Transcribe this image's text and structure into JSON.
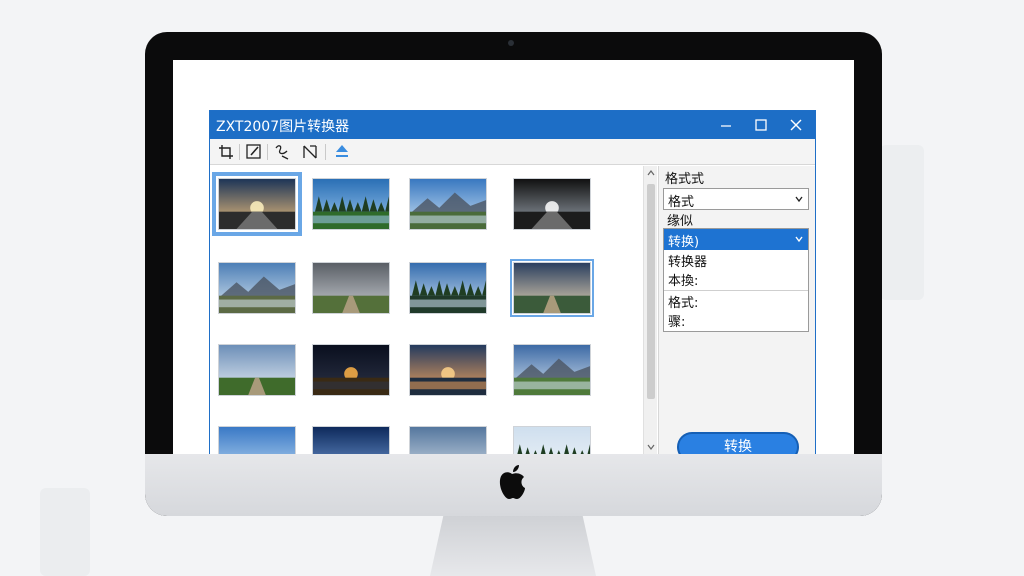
{
  "window": {
    "title": "ZXT2007图片转换器",
    "controls": [
      "minimize-icon",
      "maximize-icon",
      "close-icon"
    ]
  },
  "toolbar": {
    "tools": [
      "crop-icon",
      "edit-icon",
      "effects-icon",
      "resize-icon",
      "upload-icon"
    ]
  },
  "gallery": {
    "thumbnails": [
      {
        "scene": "sunset-road",
        "selected": true
      },
      {
        "scene": "forest-road"
      },
      {
        "scene": "mountain-lake"
      },
      {
        "scene": "sunburst-road"
      },
      {
        "scene": "mountain-meadow"
      },
      {
        "scene": "cloudy-field-path"
      },
      {
        "scene": "forest-lake"
      },
      {
        "scene": "lakeside-sunset",
        "selected": true
      },
      {
        "scene": "green-path"
      },
      {
        "scene": "night-city-reflection"
      },
      {
        "scene": "sunset-water"
      },
      {
        "scene": "valley-field"
      },
      {
        "scene": "palm-sky"
      },
      {
        "scene": "blue-sky-dusk"
      },
      {
        "scene": "cloudy-horizon"
      },
      {
        "scene": "tree-line"
      }
    ]
  },
  "panel": {
    "heading": "格式式",
    "format_select_value": "格式",
    "static_label": "缘似",
    "dropdown": {
      "selected": "转换)",
      "items": [
        "转换器",
        "本換:",
        "格式:",
        "骤:"
      ]
    },
    "convert_label": "转换"
  },
  "colors": {
    "titlebar": "#1d6ec6",
    "accent": "#1e73d2",
    "selection_outline": "#6aa7e6"
  }
}
